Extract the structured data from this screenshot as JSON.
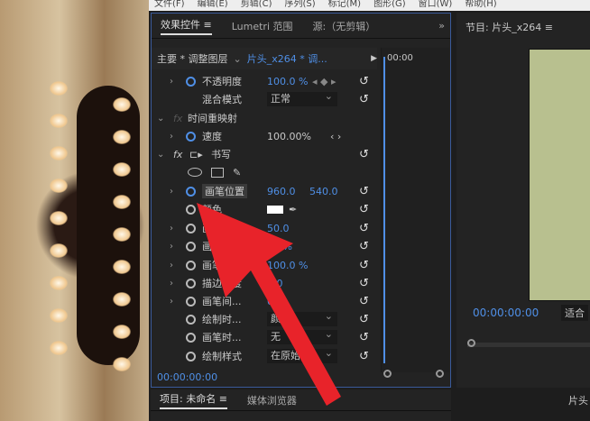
{
  "menu": [
    "文件(F)",
    "编辑(E)",
    "剪辑(C)",
    "序列(S)",
    "标记(M)",
    "图形(G)",
    "窗口(W)",
    "帮助(H)"
  ],
  "effect_controls": {
    "tabs": [
      "效果控件 ≡",
      "Lumetri 范围",
      "源:（无剪辑）"
    ],
    "overflow": "»",
    "master": "主要 * 调整图层",
    "clip": "片头_x264 * 调...",
    "ruler_time": "00:00",
    "rows": [
      {
        "label": "不透明度",
        "v1": "100.0 %",
        "v2": "◂ ◆ ▸"
      },
      {
        "label": "混合模式",
        "dropdown": "正常"
      },
      {
        "label": "时间重映射"
      },
      {
        "label": "速度",
        "v1": "100.00%",
        "v2": "‹ ›"
      },
      {
        "label": "书写"
      },
      {
        "label": "画笔位置",
        "v1": "960.0",
        "v2": "540.0"
      },
      {
        "label": "颜色"
      },
      {
        "label": "画笔大小",
        "v1": "50.0"
      },
      {
        "label": "画笔硬度",
        "v1": "79 %"
      },
      {
        "label": "画笔不透明度",
        "v1": "100.0 %"
      },
      {
        "label": "描边长度",
        "v1": "0.0"
      },
      {
        "label": "画笔间...",
        "v1": "0.0"
      },
      {
        "label": "绘制时...",
        "dropdown": "颜色"
      },
      {
        "label": "画笔时...",
        "dropdown": "无"
      },
      {
        "label": "绘制样式",
        "dropdown": "在原始..."
      }
    ],
    "timecode": "00:00:00:00"
  },
  "project": {
    "tabs": [
      "项目: 未命名 ≡",
      "媒体浏览器"
    ]
  },
  "program": {
    "title": "节目: 片头_x264 ≡",
    "timecode": "00:00:00:00",
    "fit": "适合",
    "seq_tab": "片头"
  }
}
